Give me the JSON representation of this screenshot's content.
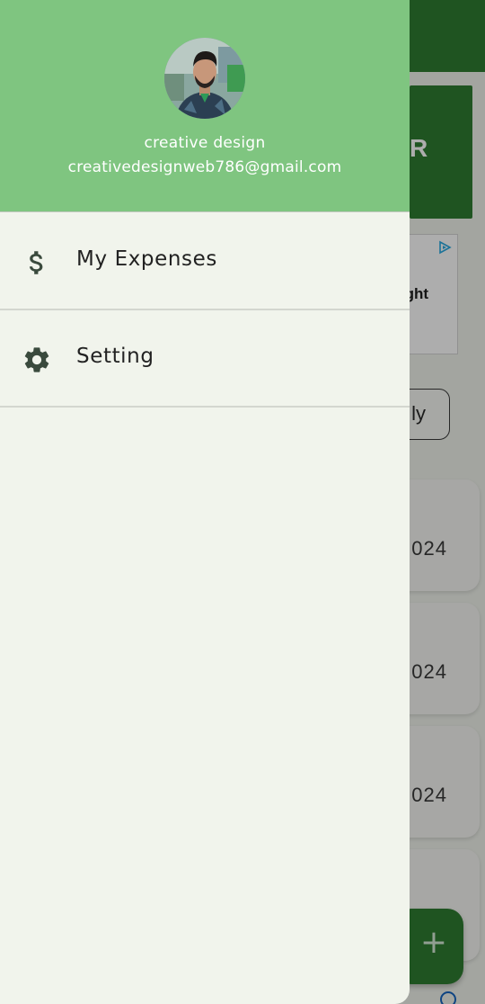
{
  "colors": {
    "header_green": "#7fc580",
    "app_bar_green": "#2e7d32",
    "drawer_background": "#f1f4ec",
    "divider": "#d3d6cf",
    "icon_dark": "#3a4a3d"
  },
  "drawer": {
    "header": {
      "avatar_icon": "user-photo",
      "name": "creative design",
      "email": "creativedesignweb786@gmail.com"
    },
    "items": [
      {
        "label": "My Expenses",
        "icon": "dollar-icon"
      },
      {
        "label": "Setting",
        "icon": "gear-icon"
      }
    ]
  },
  "background": {
    "banner_letter": "R",
    "ad_text": "ght",
    "filter_chip_label": "ly",
    "cards": [
      {
        "date_fragment": "024"
      },
      {
        "date_fragment": "024"
      },
      {
        "date_fragment": "024"
      }
    ],
    "fab_label": "+"
  }
}
